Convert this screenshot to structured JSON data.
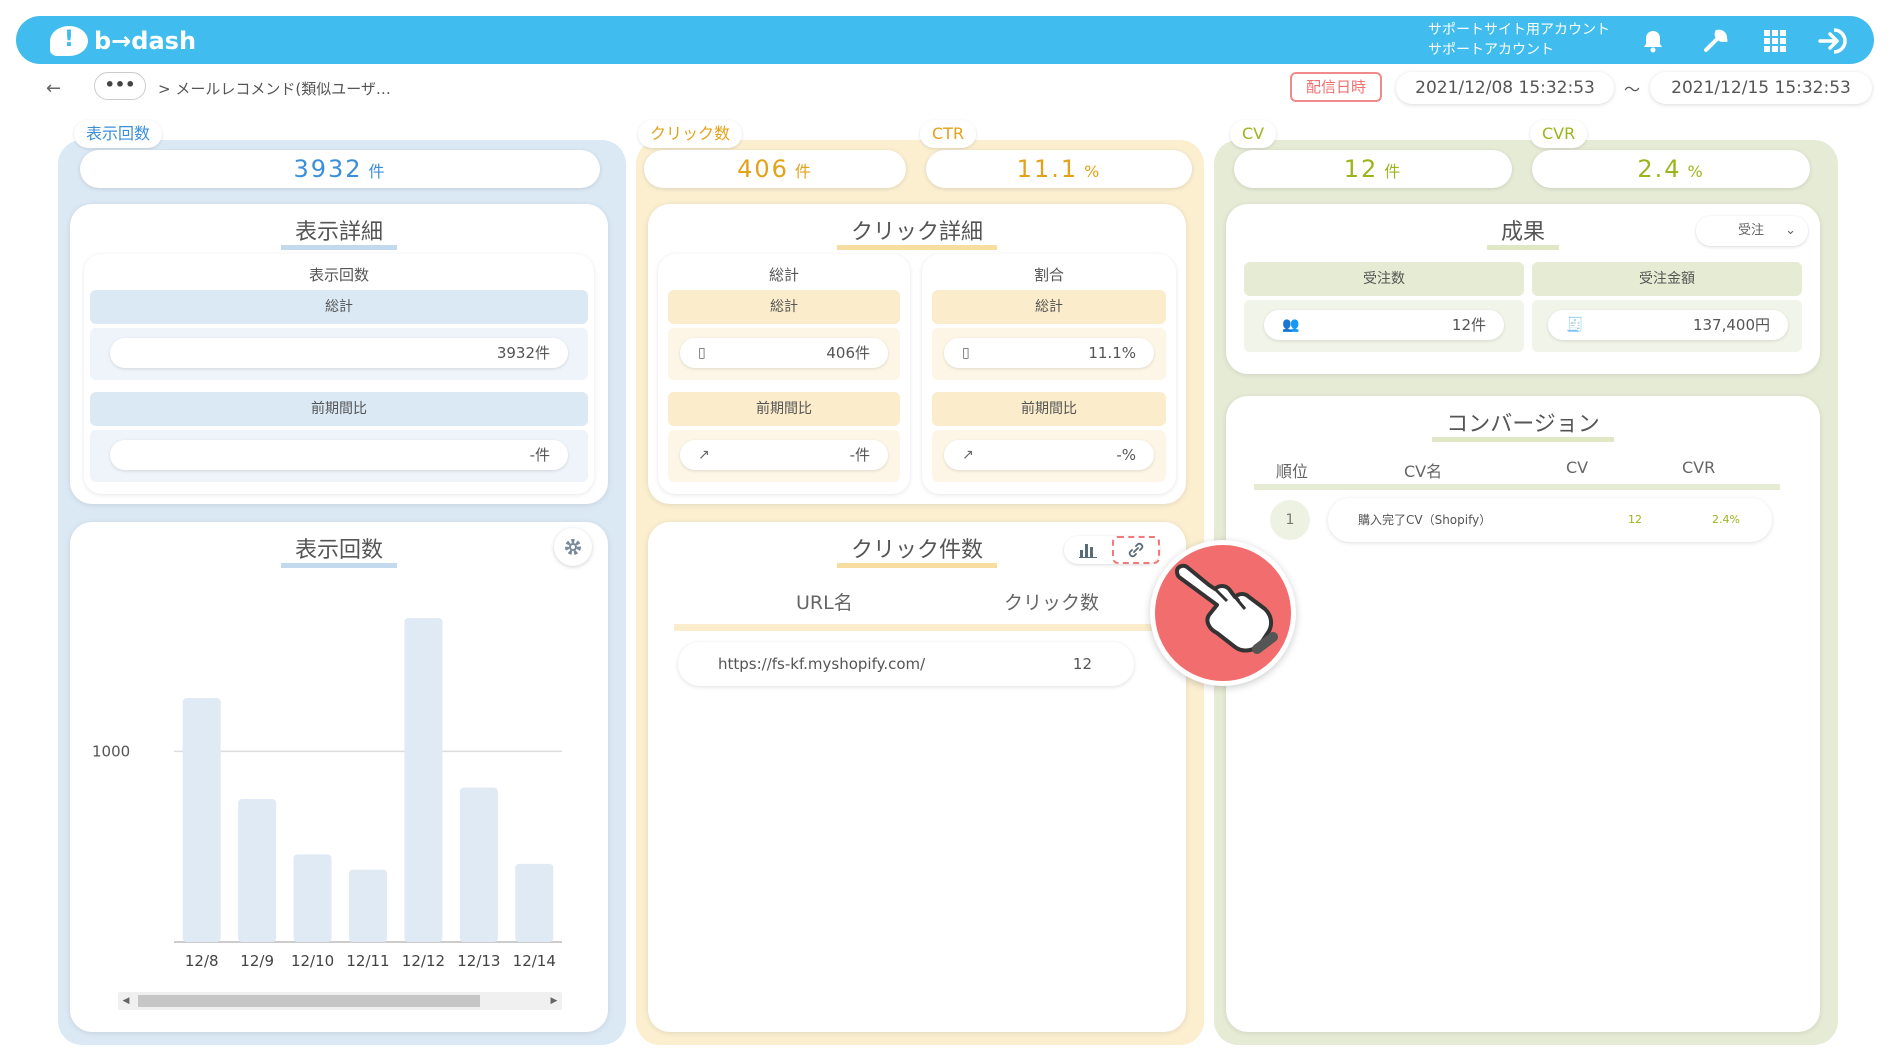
{
  "header": {
    "brand": "b→dash",
    "account_line1": "サポートサイト用アカウント",
    "account_line2": "サポートアカウント",
    "color": "#40bdee"
  },
  "nav": {
    "back": "←",
    "dots": "•••",
    "breadcrumb": "> メールレコメンド(類似ユーザ…",
    "date_badge": "配信日時",
    "date_from": "2021/12/08 15:32:53",
    "tilde": "〜",
    "date_to": "2021/12/15 15:32:53"
  },
  "impressions": {
    "tag": "表示回数",
    "value": "3932",
    "unit": "件",
    "detail_title": "表示詳細",
    "sub_title": "表示回数",
    "total_label": "総計",
    "total_value": "3932件",
    "prev_label": "前期間比",
    "prev_value": "-件",
    "chart_title": "表示回数"
  },
  "clicks": {
    "tag": "クリック数",
    "value": "406",
    "unit": "件",
    "ctr_tag": "CTR",
    "ctr_value": "11.1",
    "ctr_unit": "%",
    "detail_title": "クリック詳細",
    "left_title": "総計",
    "left_total_label": "総計",
    "left_total_value": "406件",
    "left_prev_label": "前期間比",
    "left_prev_value": "-件",
    "right_title": "割合",
    "right_total_label": "総計",
    "right_total_value": "11.1%",
    "right_prev_label": "前期間比",
    "right_prev_value": "-%",
    "count_title": "クリック件数",
    "col_url": "URL名",
    "col_clicks": "クリック数",
    "rows": [
      {
        "url": "https://fs-kf.myshopify.com/",
        "clicks": "12"
      }
    ]
  },
  "conversions": {
    "cv_tag": "CV",
    "cv_value": "12",
    "cv_unit": "件",
    "cvr_tag": "CVR",
    "cvr_value": "2.4",
    "cvr_unit": "%",
    "result_title": "成果",
    "select_value": "受注",
    "orders_label": "受注数",
    "orders_value": "12件",
    "amount_label": "受注金額",
    "amount_value": "137,400円",
    "cv_title": "コンバージョン",
    "col_rank": "順位",
    "col_name": "CV名",
    "col_cv": "CV",
    "col_cvr": "CVR",
    "rows": [
      {
        "rank": "1",
        "name": "購入完了CV（Shopify）",
        "cv": "12",
        "cvr": "2.4%"
      }
    ]
  },
  "chart_data": {
    "type": "bar",
    "categories": [
      "12/8",
      "12/9",
      "12/10",
      "12/11",
      "12/12",
      "12/13",
      "12/14"
    ],
    "values": [
      1280,
      750,
      460,
      380,
      1700,
      810,
      410
    ],
    "y_tick_label": "1000",
    "ylim": [
      0,
      1700
    ],
    "bar_color": "#dfeaf5"
  }
}
